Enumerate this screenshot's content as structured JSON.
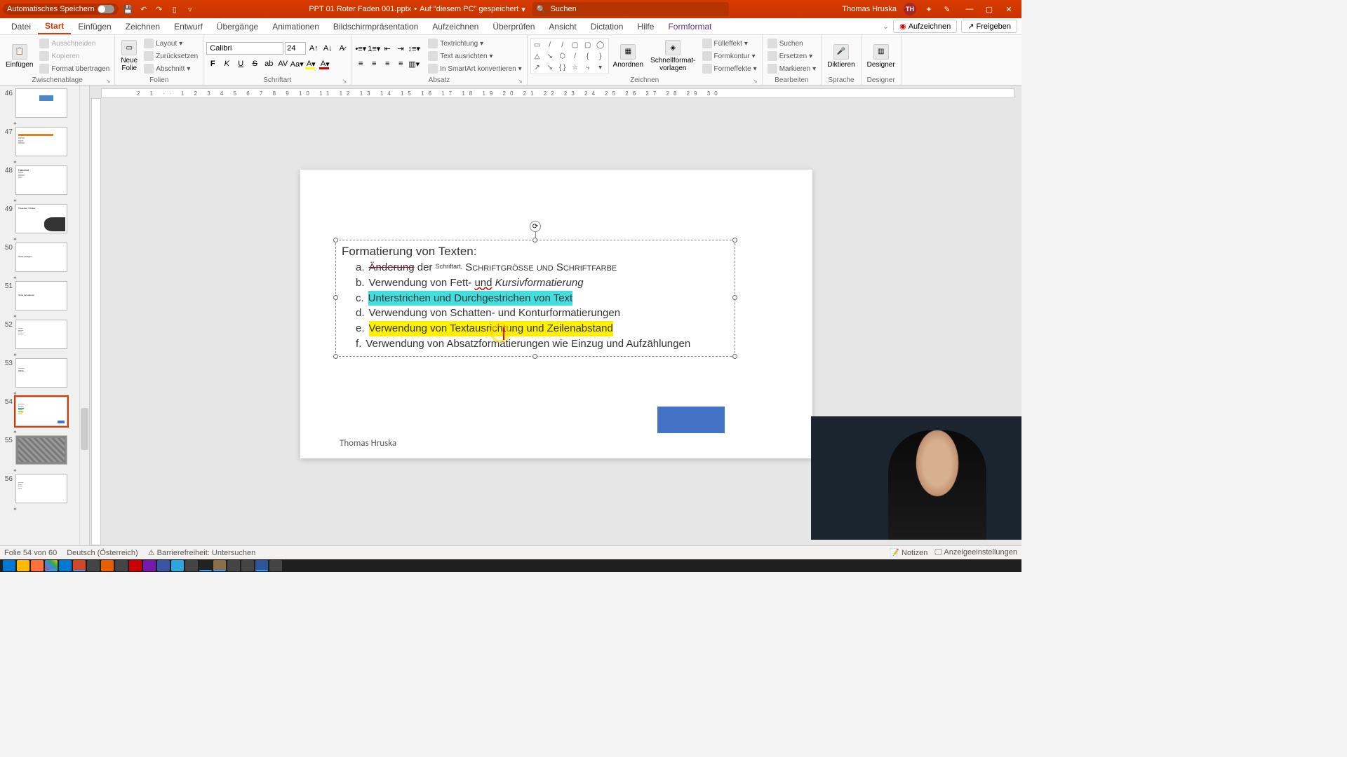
{
  "titlebar": {
    "autosave": "Automatisches Speichern",
    "doc_name": "PPT 01 Roter Faden 001.pptx",
    "save_location": "Auf \"diesem PC\" gespeichert",
    "search_placeholder": "Suchen",
    "user_name": "Thomas Hruska",
    "user_initials": "TH"
  },
  "tabs": {
    "datei": "Datei",
    "start": "Start",
    "einfuegen": "Einfügen",
    "zeichnen": "Zeichnen",
    "entwurf": "Entwurf",
    "uebergaenge": "Übergänge",
    "animationen": "Animationen",
    "bildschirm": "Bildschirmpräsentation",
    "aufzeichnen_tab": "Aufzeichnen",
    "ueberpruefen": "Überprüfen",
    "ansicht": "Ansicht",
    "dictation": "Dictation",
    "hilfe": "Hilfe",
    "formformat": "Formformat",
    "aufzeichnen_btn": "Aufzeichnen",
    "freigeben": "Freigeben"
  },
  "ribbon": {
    "clipboard": {
      "label": "Zwischenablage",
      "einfuegen": "Einfügen",
      "ausschneiden": "Ausschneiden",
      "kopieren": "Kopieren",
      "format": "Format übertragen"
    },
    "folien": {
      "label": "Folien",
      "neue": "Neue\nFolie",
      "layout": "Layout",
      "zuruecksetzen": "Zurücksetzen",
      "abschnitt": "Abschnitt"
    },
    "schriftart": {
      "label": "Schriftart",
      "font": "Calibri",
      "size": "24"
    },
    "absatz": {
      "label": "Absatz",
      "textrichtung": "Textrichtung",
      "ausrichten": "Text ausrichten",
      "smartart": "In SmartArt konvertieren"
    },
    "zeichnen": {
      "label": "Zeichnen",
      "anordnen": "Anordnen",
      "schnell": "Schnellformat-\nvorlagen",
      "fuell": "Fülleffekt",
      "kontur": "Formkontur",
      "effekte": "Formeffekte"
    },
    "bearbeiten": {
      "label": "Bearbeiten",
      "suchen": "Suchen",
      "ersetzen": "Ersetzen",
      "markieren": "Markieren"
    },
    "sprache": {
      "label": "Sprache",
      "diktieren": "Diktieren"
    },
    "designer": {
      "label": "Designer",
      "btn": "Designer"
    }
  },
  "thumbs": {
    "n46": "46",
    "n47": "47",
    "n48": "48",
    "n49": "49",
    "n50": "50",
    "n51": "51",
    "n52": "52",
    "n53": "53",
    "n54": "54",
    "n55": "55",
    "n56": "56"
  },
  "slide": {
    "title": "Formatierung von Texten:",
    "a_letter": "a.",
    "a_strike": "Änderung",
    "a_der": "der",
    "a_schrift": "Schriftart,",
    "a_caps": "Schriftgröße und Schriftfarbe",
    "b_letter": "b.",
    "b_text": "Verwendung von Fett-",
    "b_und": "und",
    "b_kursiv": "Kursivformatierung",
    "c_letter": "c.",
    "c_text": "Unterstrichen und Durchgestrichen von Text",
    "d_letter": "d.",
    "d_text": "Verwendung von Schatten- und Konturformatierungen",
    "e_letter": "e.",
    "e_text": "Verwendung von Textausrichtung und Zeilenabstand",
    "f_letter": "f.",
    "f_text": "Verwendung von Absatzformatierungen wie Einzug und Aufzählungen",
    "footer": "Thomas Hruska"
  },
  "status": {
    "slide_info": "Folie 54 von 60",
    "language": "Deutsch (Österreich)",
    "accessibility": "Barrierefreiheit: Untersuchen",
    "notizen": "Notizen",
    "anzeige": "Anzeigeeinstellungen"
  }
}
